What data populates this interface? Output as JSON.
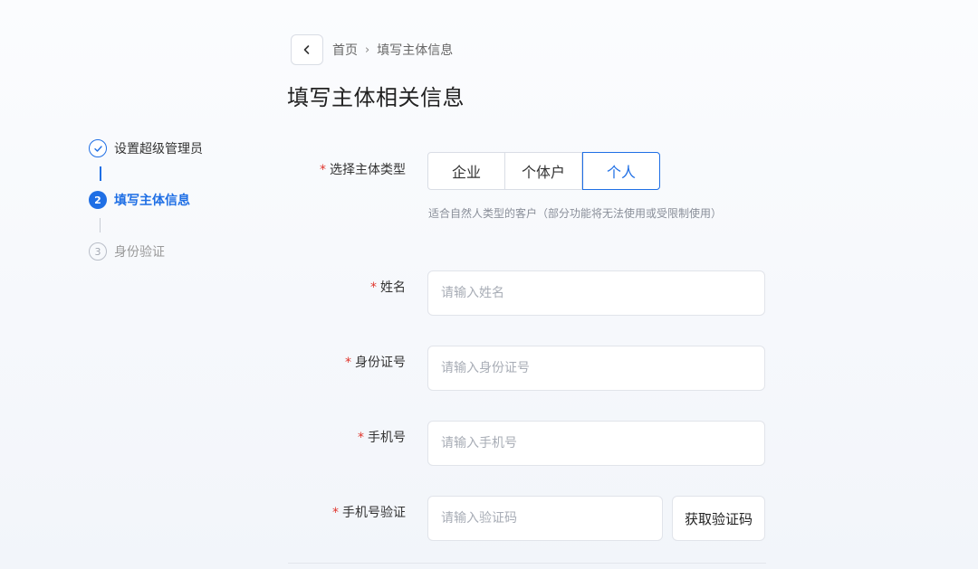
{
  "header": {
    "breadcrumb": [
      "首页",
      "填写主体信息"
    ],
    "title": "填写主体相关信息"
  },
  "steps": [
    {
      "number": "✓",
      "label": "设置超级管理员",
      "state": "done"
    },
    {
      "number": "2",
      "label": "填写主体信息",
      "state": "active"
    },
    {
      "number": "3",
      "label": "身份验证",
      "state": "pending"
    }
  ],
  "form": {
    "type_label": "选择主体类型",
    "type_options": [
      "企业",
      "个体户",
      "个人"
    ],
    "type_selected": "个人",
    "type_hint": "适合自然人类型的客户（部分功能将无法使用或受限制使用）",
    "name_label": "姓名",
    "name_placeholder": "请输入姓名",
    "id_label": "身份证号",
    "id_placeholder": "请输入身份证号",
    "phone_label": "手机号",
    "phone_placeholder": "请输入手机号",
    "code_label": "手机号验证",
    "code_placeholder": "请输入验证码",
    "code_button": "获取验证码"
  },
  "colors": {
    "accent": "#1f6fe5",
    "required": "#e0352c"
  }
}
